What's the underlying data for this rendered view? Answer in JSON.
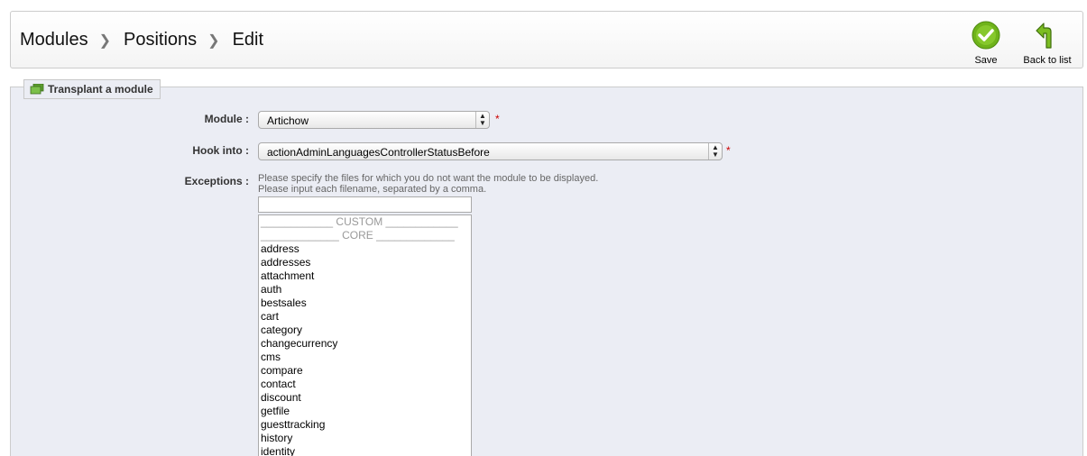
{
  "breadcrumb": [
    "Modules",
    "Positions",
    "Edit"
  ],
  "toolbar": {
    "save_label": "Save",
    "back_label": "Back to list"
  },
  "form": {
    "legend": "Transplant a module",
    "module_label": "Module :",
    "module_value": "Artichow",
    "hook_label": "Hook into :",
    "hook_value": "actionAdminLanguagesControllerStatusBefore",
    "required_mark": "*",
    "exceptions_label": "Exceptions :",
    "help_line1": "Please specify the files for which you do not want the module to be displayed.",
    "help_line2": "Please input each filename, separated by a comma.",
    "exceptions_value": ""
  },
  "exception_list": {
    "custom_header": "____________ CUSTOM ____________",
    "core_header": "_____________ CORE _____________",
    "items": [
      "address",
      "addresses",
      "attachment",
      "auth",
      "bestsales",
      "cart",
      "category",
      "changecurrency",
      "cms",
      "compare",
      "contact",
      "discount",
      "getfile",
      "guesttracking",
      "history",
      "identity"
    ]
  },
  "colors": {
    "accent_green": "#6fb31b",
    "panel_bg": "#ebedf4",
    "required": "#cc0000"
  }
}
